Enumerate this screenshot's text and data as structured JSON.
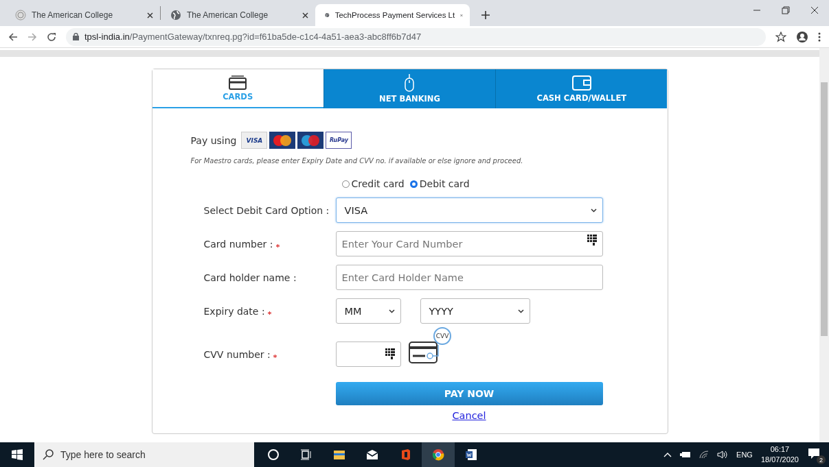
{
  "browser": {
    "tabs": [
      {
        "title": "The American College",
        "selected": false,
        "kind": "seal"
      },
      {
        "title": "The American College",
        "selected": false,
        "kind": "globe"
      },
      {
        "title": "TechProcess Payment Services Lt",
        "selected": true,
        "kind": "globe"
      }
    ],
    "address": {
      "host": "tpsl-india.in",
      "path": "/PaymentGateway/txnreq.pg?id=f61ba5de-c1c4-4a51-aea3-abc8ff6b7d47"
    }
  },
  "payment_tabs": [
    {
      "label": "CARDS",
      "selected": true,
      "kind": "card"
    },
    {
      "label": "NET BANKING",
      "selected": false,
      "kind": "mouse"
    },
    {
      "label": "CASH CARD/WALLET",
      "selected": false,
      "kind": "wallet"
    }
  ],
  "pay_using": {
    "label": "Pay using",
    "logos": [
      {
        "kind": "visa",
        "text": "VISA"
      },
      {
        "kind": "mastercard"
      },
      {
        "kind": "maestro"
      },
      {
        "kind": "rupay",
        "text": "RuPay"
      }
    ]
  },
  "note": "For Maestro cards, please enter Expiry Date and CVV no. if available or else ignore and proceed.",
  "card_type": [
    {
      "label": "Credit card",
      "selected": false
    },
    {
      "label": "Debit card",
      "selected": true
    }
  ],
  "fields": [
    {
      "kind": "select",
      "label": "Select Debit Card Option :",
      "required": false,
      "value": "VISA"
    },
    {
      "kind": "input",
      "label": "Card number :",
      "required": true,
      "placeholder": "Enter Your Card Number",
      "keypad": true
    },
    {
      "kind": "input",
      "label": "Card holder name :",
      "required": false,
      "placeholder": "Enter Card Holder Name",
      "keypad": false
    },
    {
      "kind": "expiry",
      "label": "Expiry date :",
      "required": true,
      "month": "MM",
      "year": "YYYY"
    },
    {
      "kind": "cvv",
      "label": "CVV number :",
      "required": true,
      "hint": "CVV"
    }
  ],
  "pay_button": "PAY NOW",
  "cancel_link": "Cancel",
  "taskbar": {
    "search_placeholder": "Type here to search",
    "language": "ENG",
    "time": "06:17",
    "date": "18/07/2020",
    "notifications": "2"
  }
}
